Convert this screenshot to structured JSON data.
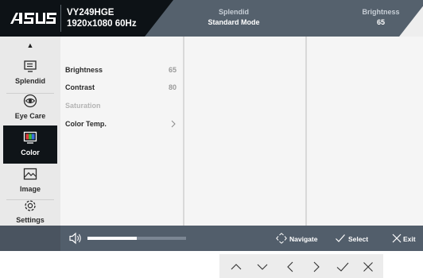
{
  "header": {
    "brand": "/ISUS",
    "model": "VY249HGE",
    "resolution": "1920x1080 60Hz",
    "mode_label": "Splendid",
    "mode_value": "Standard Mode",
    "brightness_label": "Brightness",
    "brightness_value": "65"
  },
  "sidebar": {
    "up_arrow": "▲",
    "down_arrow": "▼",
    "items": [
      {
        "label": "Splendid",
        "icon": "splendid-icon",
        "active": false
      },
      {
        "label": "Eye Care",
        "icon": "eye-care-icon",
        "active": false
      },
      {
        "label": "Color",
        "icon": "color-icon",
        "active": true
      },
      {
        "label": "Image",
        "icon": "image-icon",
        "active": false
      },
      {
        "label": "Settings",
        "icon": "settings-icon",
        "active": false
      }
    ]
  },
  "menu": {
    "items": [
      {
        "label": "Brightness",
        "value": "65",
        "enabled": true
      },
      {
        "label": "Contrast",
        "value": "80",
        "enabled": true
      },
      {
        "label": "Saturation",
        "value": "",
        "enabled": false
      },
      {
        "label": "Color Temp.",
        "value": "",
        "enabled": true,
        "has_submenu": true
      }
    ]
  },
  "footer": {
    "volume_level": 0.5,
    "navigate_label": "Navigate",
    "select_label": "Select",
    "exit_label": "Exit"
  },
  "keys": [
    "up-key-icon",
    "down-key-icon",
    "left-key-icon",
    "right-key-icon",
    "confirm-key-icon",
    "close-key-icon"
  ],
  "colors": {
    "header_dark": "#0d1216",
    "header_grey": "#55616d",
    "footer": "#525e6b",
    "active_nav": "#0f1418"
  }
}
